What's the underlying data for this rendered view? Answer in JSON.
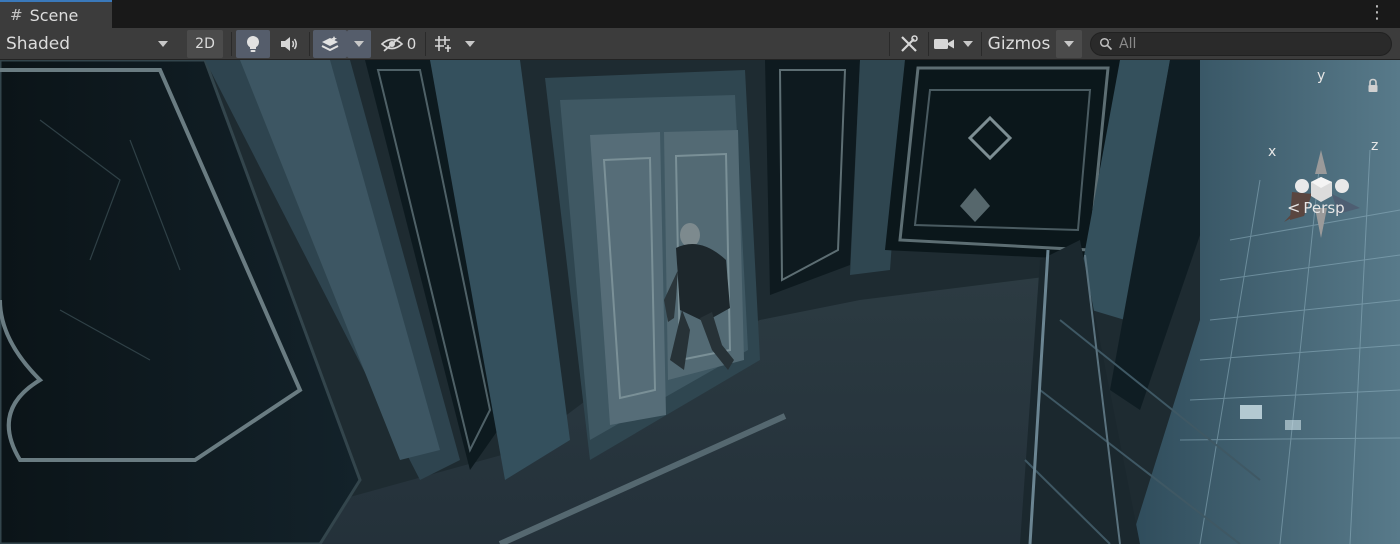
{
  "tab": {
    "icon": "hash-icon",
    "label": "Scene"
  },
  "toolbar": {
    "draw_mode": "Shaded",
    "btn_2d": "2D",
    "hidden_count": "0",
    "gizmos_label": "Gizmos",
    "search_placeholder": "All"
  },
  "viewport": {
    "axis_x": "x",
    "axis_y": "y",
    "axis_z": "z",
    "projection": "Persp"
  },
  "colors": {
    "toolbar_bg": "#3c3c3c",
    "tab_active_accent": "#3a79bb",
    "toggle_on_bg": "#555d6b",
    "gizmo_x": "#5a4640",
    "gizmo_y": "#8a8a8a",
    "gizmo_z": "#4e5e72"
  }
}
